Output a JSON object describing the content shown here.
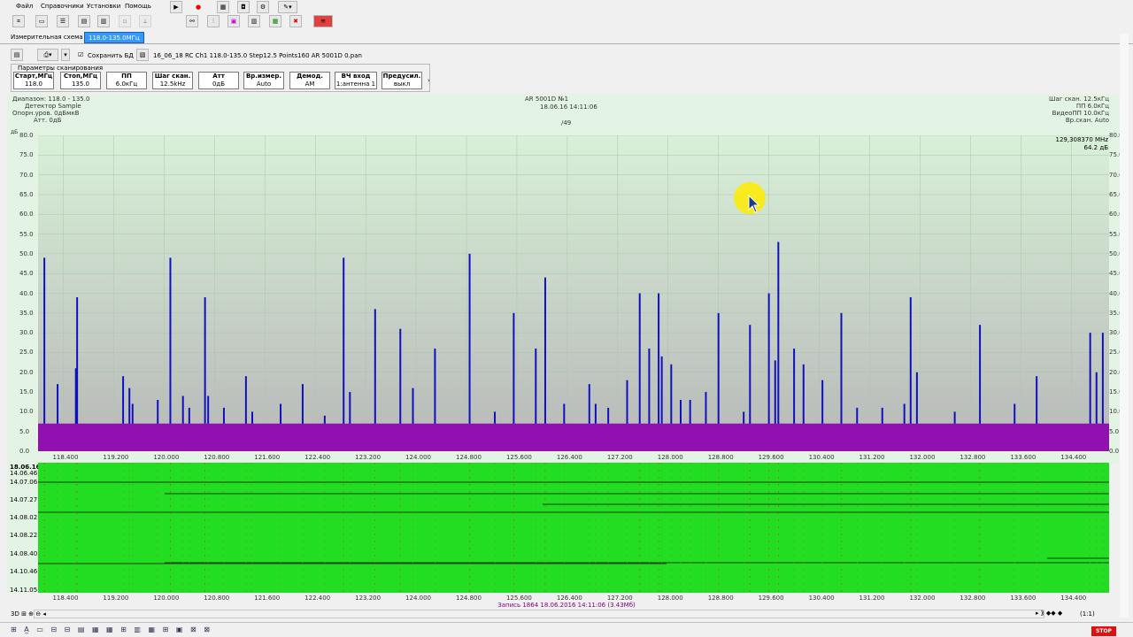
{
  "menu": [
    "Файл",
    "Справочники",
    "Установки",
    "Помощь"
  ],
  "tabs": [
    {
      "label": "Измерительная схема",
      "active": false
    },
    {
      "label": "118.0-135.0МГц",
      "active": true
    }
  ],
  "row2": {
    "save_checkbox_label": "Сохранить БД",
    "file_name": "16_06_18 RC  Ch1 118.0-135.0 Step12.5 Points160 AR 5001D 0.pan"
  },
  "params": {
    "title": "Параметры сканирования",
    "buttons": [
      {
        "label": "Старт,МГц",
        "value": "118.0"
      },
      {
        "label": "Стоп,МГц",
        "value": "135.0"
      },
      {
        "label": "ПП",
        "value": "6.0кГц"
      },
      {
        "label": "Шаг скан.",
        "value": "12.5kHz"
      },
      {
        "label": "Атт",
        "value": "0дБ"
      },
      {
        "label": "Вр.измер.",
        "value": "Auto"
      },
      {
        "label": "Демод.",
        "value": "AM"
      },
      {
        "label": "ВЧ вход",
        "value": "1:антенна 1"
      },
      {
        "label": "Предусил.",
        "value": "выкл"
      }
    ]
  },
  "info_left": [
    {
      "k": "Диапазон:",
      "v": "118.0 - 135.0"
    },
    {
      "k": "Детектор",
      "v": "Sample"
    },
    {
      "k": "Опорн.уров.",
      "v": "0дБмкВ"
    },
    {
      "k": "Атт.",
      "v": "0дБ"
    }
  ],
  "info_center": {
    "device": "AR 5001D №1",
    "datetime": "18.06.16 14:11:06",
    "count": "/49"
  },
  "info_right": [
    {
      "k": "Шаг скан.",
      "v": "12.5кГц"
    },
    {
      "k": "ПП",
      "v": "6.0кГц"
    },
    {
      "k": "ВидеоПП",
      "v": "10.0кГц"
    },
    {
      "k": "Вр.скан.",
      "v": "Auto"
    }
  ],
  "marker": {
    "freq": "129,308370 MHz",
    "level": "64.2 дБ"
  },
  "units": "дБ",
  "chart_data": {
    "type": "bar",
    "title": "",
    "xlim": [
      118.0,
      135.0
    ],
    "ylim": [
      0,
      80
    ],
    "x_ticks": [
      "118.400",
      "119.200",
      "120.000",
      "120.800",
      "121.600",
      "122.400",
      "123.200",
      "124.000",
      "124.800",
      "125.600",
      "126.400",
      "127.200",
      "128.000",
      "128.800",
      "129.600",
      "130.400",
      "131.200",
      "132.000",
      "132.800",
      "133.600",
      "134.400"
    ],
    "y_ticks": [
      "80.0",
      "75.0",
      "70.0",
      "65.0",
      "60.0",
      "55.0",
      "50.0",
      "45.0",
      "40.0",
      "35.0",
      "30.0",
      "25.0",
      "20.0",
      "15.0",
      "10.0",
      "5.0",
      "0.0"
    ],
    "noise_floor": 7,
    "colors": {
      "bg_top": "#d8f0d8",
      "bg_bottom": "#b8b8b8",
      "signal": "#1010c0",
      "floor": "#9010b0",
      "waterfall": "#22dd22"
    },
    "peaks": [
      [
        118.1,
        49
      ],
      [
        118.31,
        17
      ],
      [
        118.62,
        39
      ],
      [
        118.6,
        21
      ],
      [
        119.35,
        19
      ],
      [
        119.45,
        16
      ],
      [
        119.5,
        12
      ],
      [
        119.9,
        13
      ],
      [
        120.1,
        49
      ],
      [
        120.3,
        14
      ],
      [
        120.4,
        11
      ],
      [
        120.65,
        39
      ],
      [
        120.7,
        14
      ],
      [
        120.95,
        11
      ],
      [
        121.3,
        19
      ],
      [
        121.4,
        10
      ],
      [
        121.85,
        12
      ],
      [
        122.2,
        17
      ],
      [
        122.55,
        9
      ],
      [
        122.85,
        49
      ],
      [
        122.95,
        15
      ],
      [
        123.35,
        36
      ],
      [
        123.75,
        31
      ],
      [
        123.95,
        16
      ],
      [
        124.3,
        26
      ],
      [
        124.85,
        50
      ],
      [
        125.25,
        10
      ],
      [
        125.55,
        35
      ],
      [
        125.9,
        26
      ],
      [
        126.05,
        44
      ],
      [
        126.35,
        12
      ],
      [
        126.75,
        17
      ],
      [
        126.85,
        12
      ],
      [
        127.05,
        11
      ],
      [
        127.35,
        18
      ],
      [
        127.55,
        40
      ],
      [
        127.7,
        26
      ],
      [
        127.85,
        40
      ],
      [
        127.9,
        24
      ],
      [
        128.05,
        22
      ],
      [
        128.2,
        13
      ],
      [
        128.35,
        13
      ],
      [
        128.6,
        15
      ],
      [
        128.8,
        35
      ],
      [
        129.2,
        10
      ],
      [
        129.3,
        32
      ],
      [
        129.6,
        40
      ],
      [
        129.75,
        53
      ],
      [
        129.7,
        23
      ],
      [
        130.0,
        26
      ],
      [
        130.15,
        22
      ],
      [
        130.45,
        18
      ],
      [
        130.75,
        35
      ],
      [
        131.0,
        11
      ],
      [
        131.4,
        11
      ],
      [
        131.75,
        12
      ],
      [
        131.85,
        39
      ],
      [
        131.95,
        20
      ],
      [
        132.55,
        10
      ],
      [
        132.95,
        32
      ],
      [
        133.5,
        12
      ],
      [
        133.85,
        19
      ],
      [
        134.7,
        30
      ],
      [
        134.8,
        20
      ],
      [
        134.9,
        30
      ]
    ]
  },
  "waterfall": {
    "times": [
      "18.06.16",
      "14.06.46",
      "14.07.06",
      "14.07.27",
      "14.08.02",
      "14.08.22",
      "14.08.40",
      "14.10.46",
      "14.11.05"
    ]
  },
  "status_record": "Запись 1864 18.06.2016 14:11:06 (3.43Мб)",
  "zoom_label": "(1:1)",
  "stop_label": "STOP"
}
